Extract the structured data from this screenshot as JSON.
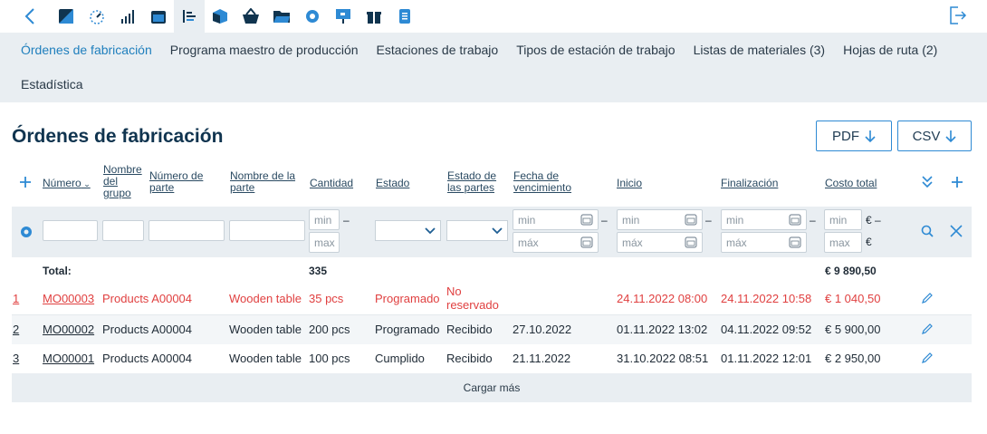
{
  "colors": {
    "accent": "#1f7fbd",
    "red": "#e04040",
    "panel": "#e9eef2"
  },
  "toolbar": {
    "icons": [
      "back-icon",
      "dashboard-icon",
      "gauge-icon",
      "bar-chart-icon",
      "calendar-icon",
      "production-icon",
      "box-icon",
      "basket-icon",
      "folder-icon",
      "gear-icon",
      "presentation-icon",
      "gift-icon",
      "document-icon"
    ],
    "exit_icon": "logout-icon"
  },
  "subnav": {
    "items": [
      "Órdenes de fabricación",
      "Programa maestro de producción",
      "Estaciones de trabajo",
      "Tipos de estación de trabajo",
      "Listas de materiales (3)",
      "Hojas de ruta (2)",
      "Estadística"
    ]
  },
  "page": {
    "title": "Órdenes de fabricación",
    "pdf_label": "PDF",
    "csv_label": "CSV"
  },
  "table": {
    "headers": {
      "numero": "Número",
      "grupo": "Nombre del grupo",
      "parte_num": "Número de parte",
      "parte_nombre": "Nombre de la parte",
      "cantidad": "Cantidad",
      "estado": "Estado",
      "estado_partes": "Estado de las partes",
      "vencimiento": "Fecha de vencimiento",
      "inicio": "Inicio",
      "finalizacion": "Finalización",
      "costo": "Costo total"
    },
    "filter": {
      "min": "min",
      "max": "max",
      "max_es": "máx",
      "dash": "–",
      "euro": "€"
    },
    "total": {
      "label": "Total:",
      "cantidad": "335",
      "costo": "€ 9 890,50"
    },
    "rows": [
      {
        "idx": "1",
        "numero": "MO00003",
        "grupo": "",
        "parte_num": "Products A00004",
        "parte_nombre": "Wooden table",
        "cantidad": "35 pcs",
        "estado": "Programado",
        "estado_partes": "No reservado",
        "vencimiento": "",
        "inicio": "24.11.2022 08:00",
        "finalizacion": "24.11.2022 10:58",
        "costo": "€ 1 040,50"
      },
      {
        "idx": "2",
        "numero": "MO00002",
        "grupo": "",
        "parte_num": "Products A00004",
        "parte_nombre": "Wooden table",
        "cantidad": "200 pcs",
        "estado": "Programado",
        "estado_partes": "Recibido",
        "vencimiento": "27.10.2022",
        "inicio": "01.11.2022 13:02",
        "finalizacion": "04.11.2022 09:52",
        "costo": "€ 5 900,00"
      },
      {
        "idx": "3",
        "numero": "MO00001",
        "grupo": "",
        "parte_num": "Products A00004",
        "parte_nombre": "Wooden table",
        "cantidad": "100 pcs",
        "estado": "Cumplido",
        "estado_partes": "Recibido",
        "vencimiento": "21.11.2022",
        "inicio": "31.10.2022 08:51",
        "finalizacion": "01.11.2022 12:01",
        "costo": "€ 2 950,00"
      }
    ],
    "load_more": "Cargar más"
  }
}
